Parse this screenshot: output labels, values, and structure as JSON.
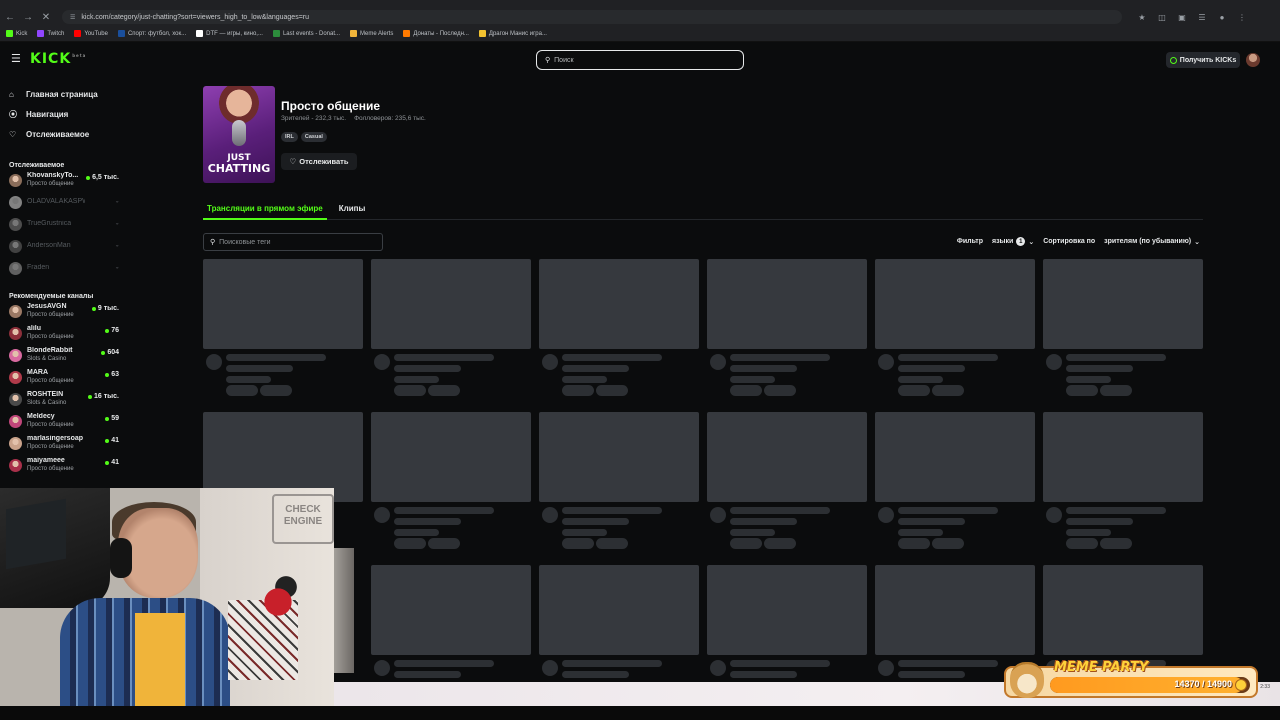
{
  "browser": {
    "url": "kick.com/category/just-chatting?sort=viewers_high_to_low&languages=ru",
    "bookmarks": [
      {
        "label": "Kick",
        "color": "#53fc18"
      },
      {
        "label": "Twitch",
        "color": "#9146ff"
      },
      {
        "label": "YouTube",
        "color": "#ff0000"
      },
      {
        "label": "Спорт: футбол, хок...",
        "color": "#1a4f9c"
      },
      {
        "label": "DTF — игры, кино,...",
        "color": "#ffffff"
      },
      {
        "label": "Last events - Donat...",
        "color": "#2c8c3c"
      },
      {
        "label": "Meme Alerts",
        "color": "#f0b43a"
      },
      {
        "label": "Донаты - Последн...",
        "color": "#ff7a00"
      },
      {
        "label": "Драгон Манис игра...",
        "color": "#f2c230"
      }
    ]
  },
  "header": {
    "logo": "KICK",
    "logo_sup": "beta",
    "search_placeholder": "Поиск",
    "get_kicks": "Получить KICKs"
  },
  "sidebar": {
    "nav": [
      {
        "label": "Главная страница",
        "icon": "home-icon"
      },
      {
        "label": "Навигация",
        "icon": "compass-icon"
      },
      {
        "label": "Отслеживаемое",
        "icon": "heart-icon"
      }
    ],
    "following_title": "Отслеживаемое",
    "following": [
      {
        "name": "KhovanskyTo...",
        "category": "Просто общение",
        "viewers": "6,5 тыс.",
        "live": true,
        "color": "#8a6d5a"
      },
      {
        "name": "OLADVALAKASPWNZ",
        "category": "",
        "viewers": "",
        "live": false,
        "color": "#d9d9d9"
      },
      {
        "name": "TrueGrustnica",
        "category": "",
        "viewers": "",
        "live": false,
        "color": "#7a7f8a"
      },
      {
        "name": "AndersonMan",
        "category": "",
        "viewers": "",
        "live": false,
        "color": "#6d6d6d"
      },
      {
        "name": "Fraden",
        "category": "",
        "viewers": "",
        "live": false,
        "color": "#a0a0a0"
      }
    ],
    "recommended_title": "Рекомендуемые каналы",
    "recommended": [
      {
        "name": "JesusAVGN",
        "category": "Просто общение",
        "viewers": "9 тыс.",
        "color": "#9a7864"
      },
      {
        "name": "alilu",
        "category": "Просто общение",
        "viewers": "76",
        "color": "#8c2f3a"
      },
      {
        "name": "BlondeRabbit",
        "category": "Slots & Casino",
        "viewers": "604",
        "color": "#d86aa0"
      },
      {
        "name": "MARA",
        "category": "Просто общение",
        "viewers": "63",
        "color": "#b03a4a"
      },
      {
        "name": "ROSHTEIN",
        "category": "Slots & Casino",
        "viewers": "16 тыс.",
        "color": "#4a4a4a"
      },
      {
        "name": "Meldecy",
        "category": "Просто общение",
        "viewers": "59",
        "color": "#c0467a"
      },
      {
        "name": "marlasingersoap",
        "category": "Просто общение",
        "viewers": "41",
        "color": "#c9a28a"
      },
      {
        "name": "maiyameee",
        "category": "Просто общение",
        "viewers": "41",
        "color": "#a8304a"
      }
    ]
  },
  "category": {
    "cover_line1": "JUST",
    "cover_line2": "CHATTING",
    "title": "Просто общение",
    "viewers": "Зрителей - 232,3 тыс.",
    "followers": "Фолловеров: 235,6 тыс.",
    "tags": [
      "IRL",
      "Casual"
    ],
    "follow_label": "Отслеживать"
  },
  "tabs": [
    {
      "label": "Трансляции в прямом эфире",
      "active": true
    },
    {
      "label": "Клипы",
      "active": false
    }
  ],
  "filters": {
    "tag_search_placeholder": "Поисковые теги",
    "filter_label": "Фильтр",
    "languages_label": "языки",
    "languages_count": "1",
    "sort_label": "Сортировка по",
    "sort_value": "зрителям (по убыванию)"
  },
  "overlay": {
    "cam_sign": "CHECK ENGINE",
    "meme_title": "MEME PARTY",
    "meme_count": "14370 / 14900",
    "meme_progress": 0.964,
    "clock": "2:33"
  }
}
